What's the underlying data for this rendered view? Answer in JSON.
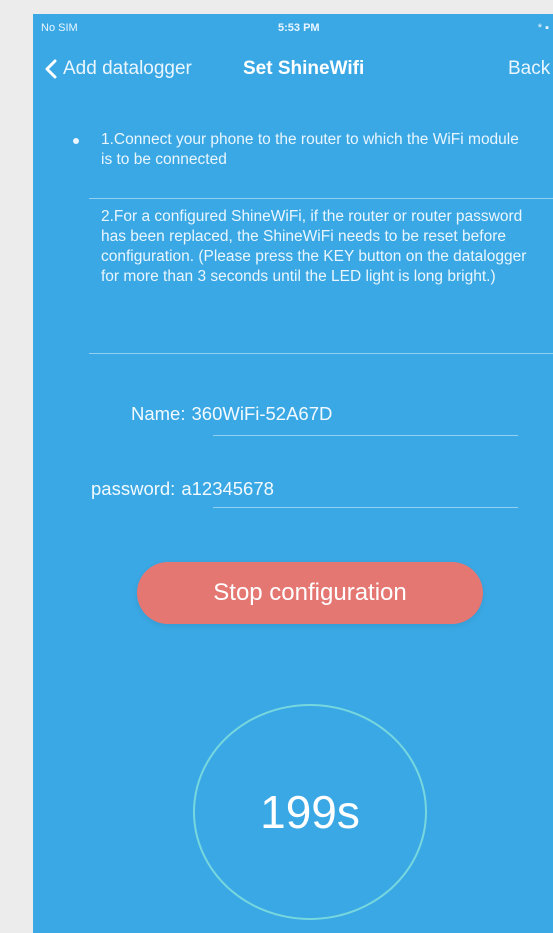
{
  "status_bar": {
    "carrier": "No SIM",
    "time": "5:53 PM",
    "right": "* ▪"
  },
  "nav": {
    "back_label": "Add datalogger",
    "title": "Set ShineWifi",
    "right_label": "Back"
  },
  "instructions": {
    "tip1": "1.Connect your phone to the router to which the WiFi module is to be connected",
    "tip2": "2.For a configured ShineWiFi, if the router or router password has been replaced, the ShineWiFi needs to be reset before configuration. (Please press the KEY button on the datalogger for more than 3 seconds until the LED light is long bright.)"
  },
  "form": {
    "name_label": "Name:",
    "name_value": "360WiFi-52A67D",
    "password_label": "password:",
    "password_value": "a12345678"
  },
  "actions": {
    "stop_label": "Stop configuration"
  },
  "countdown": {
    "value": "199s"
  },
  "colors": {
    "background": "#3aa8e4",
    "button": "#e57773",
    "ring": "#96f0dc"
  }
}
